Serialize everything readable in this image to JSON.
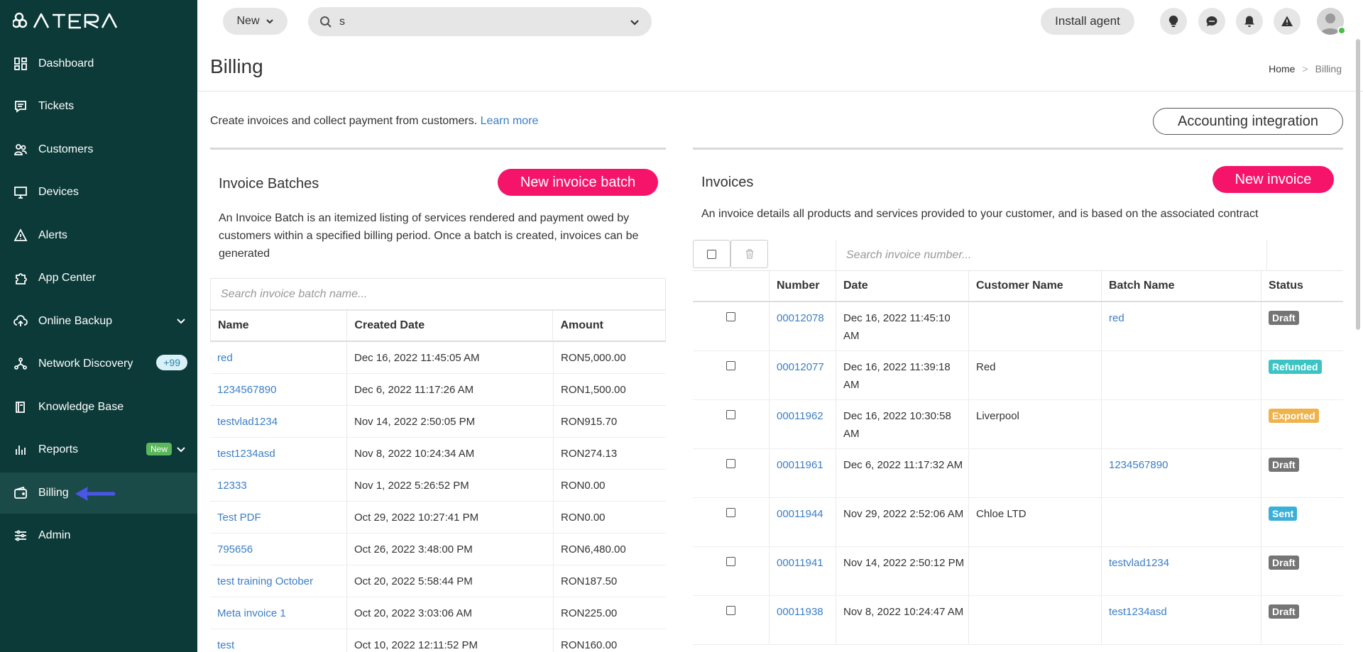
{
  "app": {
    "logo_text": "ATERA"
  },
  "sidebar": {
    "items": [
      {
        "label": "Dashboard",
        "icon": "dashboard-icon"
      },
      {
        "label": "Tickets",
        "icon": "tickets-icon"
      },
      {
        "label": "Customers",
        "icon": "customers-icon"
      },
      {
        "label": "Devices",
        "icon": "devices-icon"
      },
      {
        "label": "Alerts",
        "icon": "alerts-icon"
      },
      {
        "label": "App Center",
        "icon": "puzzle-icon"
      },
      {
        "label": "Online Backup",
        "icon": "cloud-icon"
      },
      {
        "label": "Network Discovery",
        "icon": "network-icon",
        "badge": "+99"
      },
      {
        "label": "Knowledge Base",
        "icon": "book-icon"
      },
      {
        "label": "Reports",
        "icon": "reports-icon",
        "badge": "New"
      },
      {
        "label": "Billing",
        "icon": "wallet-icon",
        "active": true
      },
      {
        "label": "Admin",
        "icon": "sliders-icon"
      }
    ]
  },
  "topbar": {
    "new_label": "New",
    "search_value": "s",
    "install_label": "Install agent"
  },
  "page": {
    "title": "Billing",
    "breadcrumb_home": "Home",
    "breadcrumb_sep": ">",
    "breadcrumb_current": "Billing",
    "intro_text": "Create invoices and collect payment from customers. ",
    "learn_more": "Learn more",
    "accounting_label": "Accounting integration"
  },
  "batches": {
    "title": "Invoice Batches",
    "new_label": "New invoice batch",
    "description": "An Invoice Batch is an itemized listing of services rendered and payment owed by customers within a specified billing period. Once a batch is created, invoices can be generated",
    "search_placeholder": "Search invoice batch name...",
    "columns": [
      "Name",
      "Created Date",
      "Amount"
    ],
    "rows": [
      {
        "name": "red",
        "date": "Dec 16, 2022 11:45:05 AM",
        "amount": "RON5,000.00"
      },
      {
        "name": "1234567890",
        "date": "Dec 6, 2022 11:17:26 AM",
        "amount": "RON1,500.00"
      },
      {
        "name": "testvlad1234",
        "date": "Nov 14, 2022 2:50:05 PM",
        "amount": "RON915.70"
      },
      {
        "name": "test1234asd",
        "date": "Nov 8, 2022 10:24:34 AM",
        "amount": "RON274.13"
      },
      {
        "name": "12333",
        "date": "Nov 1, 2022 5:26:52 PM",
        "amount": "RON0.00"
      },
      {
        "name": "Test PDF",
        "date": "Oct 29, 2022 10:27:41 PM",
        "amount": "RON0.00"
      },
      {
        "name": "795656",
        "date": "Oct 26, 2022 3:48:00 PM",
        "amount": "RON6,480.00"
      },
      {
        "name": "test training October",
        "date": "Oct 20, 2022 5:58:44 PM",
        "amount": "RON187.50"
      },
      {
        "name": "Meta invoice 1",
        "date": "Oct 20, 2022 3:03:06 AM",
        "amount": "RON225.00"
      },
      {
        "name": "test",
        "date": "Oct 10, 2022 12:11:52 PM",
        "amount": "RON160.00"
      }
    ]
  },
  "invoices": {
    "title": "Invoices",
    "new_label": "New invoice",
    "description": "An invoice details all products and services provided to your customer, and is based on the associated contract",
    "search_placeholder": "Search invoice number...",
    "columns": [
      "Number",
      "Date",
      "Customer Name",
      "Batch Name",
      "Status"
    ],
    "rows": [
      {
        "number": "00012078",
        "date": "Dec 16, 2022 11:45:10 AM",
        "customer": "",
        "batch": "red",
        "status": "Draft"
      },
      {
        "number": "00012077",
        "date": "Dec 16, 2022 11:39:18 AM",
        "customer": "Red",
        "batch": "",
        "status": "Refunded"
      },
      {
        "number": "00011962",
        "date": "Dec 16, 2022 10:30:58 AM",
        "customer": "Liverpool",
        "batch": "",
        "status": "Exported"
      },
      {
        "number": "00011961",
        "date": "Dec 6, 2022 11:17:32 AM",
        "customer": "",
        "batch": "1234567890",
        "status": "Draft"
      },
      {
        "number": "00011944",
        "date": "Nov 29, 2022 2:52:06 AM",
        "customer": "Chloe LTD",
        "batch": "",
        "status": "Sent"
      },
      {
        "number": "00011941",
        "date": "Nov 14, 2022 2:50:12 PM",
        "customer": "",
        "batch": "testvlad1234",
        "status": "Draft"
      },
      {
        "number": "00011938",
        "date": "Nov 8, 2022 10:24:47 AM",
        "customer": "",
        "batch": "test1234asd",
        "status": "Draft"
      }
    ],
    "status_colors": {
      "Draft": "#757575",
      "Refunded": "#3cc4c4",
      "Exported": "#f0b24a",
      "Sent": "#3ab0d8"
    }
  },
  "colors": {
    "sidebar_bg": "#0b3a38",
    "accent_pink": "#f5146a",
    "link": "#3b7ec4",
    "pointer_arrow": "#4a56e8"
  }
}
